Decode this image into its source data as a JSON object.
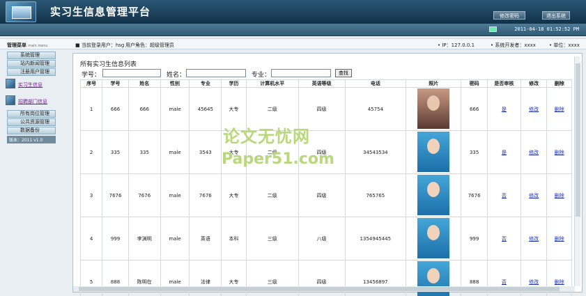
{
  "header": {
    "title": "实习生信息管理平台",
    "change_password": "修改密码",
    "logout": "退出系统",
    "datetime": "2011-04-18 01:52:52 PM"
  },
  "info": {
    "current_user_label": "当前登录用户：",
    "current_user": "hsg",
    "role_label": "用户角色：",
    "role": "超级管理员",
    "ip_label": "IP：",
    "ip": "127.0.0.1",
    "developer_label": "系统开发者：",
    "developer": "xxxx",
    "unit_label": "单位：",
    "unit": "xxxx"
  },
  "sidebar": {
    "title": "管理菜单",
    "title_en": "main menu",
    "items_top": [
      "系统管理",
      "站内新闻管理",
      "注册用户管理"
    ],
    "group1": "实习生信息",
    "group2": "招聘部门信息",
    "items_bottom": [
      "所有岗位管理",
      "公共资源管理",
      "数据备份"
    ],
    "version": "版本：2011 v1.0"
  },
  "main": {
    "panel_title": "所有实习生信息列表",
    "search": {
      "id_label": "学号：",
      "name_label": "姓名：",
      "major_label": "专业：",
      "button": "查找"
    },
    "columns": [
      "序号",
      "学号",
      "姓名",
      "性别",
      "专业",
      "学历",
      "计算机水平",
      "英语等级",
      "电话",
      "照片",
      "密码",
      "是否审核",
      "修改",
      "删除"
    ],
    "rows": [
      {
        "no": "1",
        "sid": "666",
        "name": "666",
        "gender": "male",
        "major": "45645",
        "edu": "大专",
        "computer": "二级",
        "english": "四级",
        "phone": "45754",
        "photo": "brown",
        "pwd": "666",
        "audit": "是",
        "edit": "修改",
        "del": "删除"
      },
      {
        "no": "2",
        "sid": "335",
        "name": "335",
        "gender": "male",
        "major": "3543",
        "edu": "大专",
        "computer": "二级",
        "english": "四级",
        "phone": "34543534",
        "photo": "blue",
        "pwd": "335",
        "audit": "是",
        "edit": "修改",
        "del": "删除"
      },
      {
        "no": "3",
        "sid": "7676",
        "name": "7676",
        "gender": "male",
        "major": "7676",
        "edu": "大专",
        "computer": "二级",
        "english": "四级",
        "phone": "765765",
        "photo": "blue",
        "pwd": "7676",
        "audit": "否",
        "edit": "修改",
        "del": "删除"
      },
      {
        "no": "4",
        "sid": "999",
        "name": "李渊明",
        "gender": "male",
        "major": "英语",
        "edu": "本科",
        "computer": "三级",
        "english": "八级",
        "phone": "1354945445",
        "photo": "blue",
        "pwd": "999",
        "audit": "否",
        "edit": "修改",
        "del": "删除"
      },
      {
        "no": "5",
        "sid": "888",
        "name": "陈明在",
        "gender": "male",
        "major": "法律",
        "edu": "大专",
        "computer": "三级",
        "english": "四级",
        "phone": "13456897",
        "photo": "blue",
        "pwd": "888",
        "audit": "否",
        "edit": "修改",
        "del": "删除"
      }
    ]
  },
  "watermark": {
    "line1": "论文无忧网",
    "line2": "Paper51.com"
  }
}
